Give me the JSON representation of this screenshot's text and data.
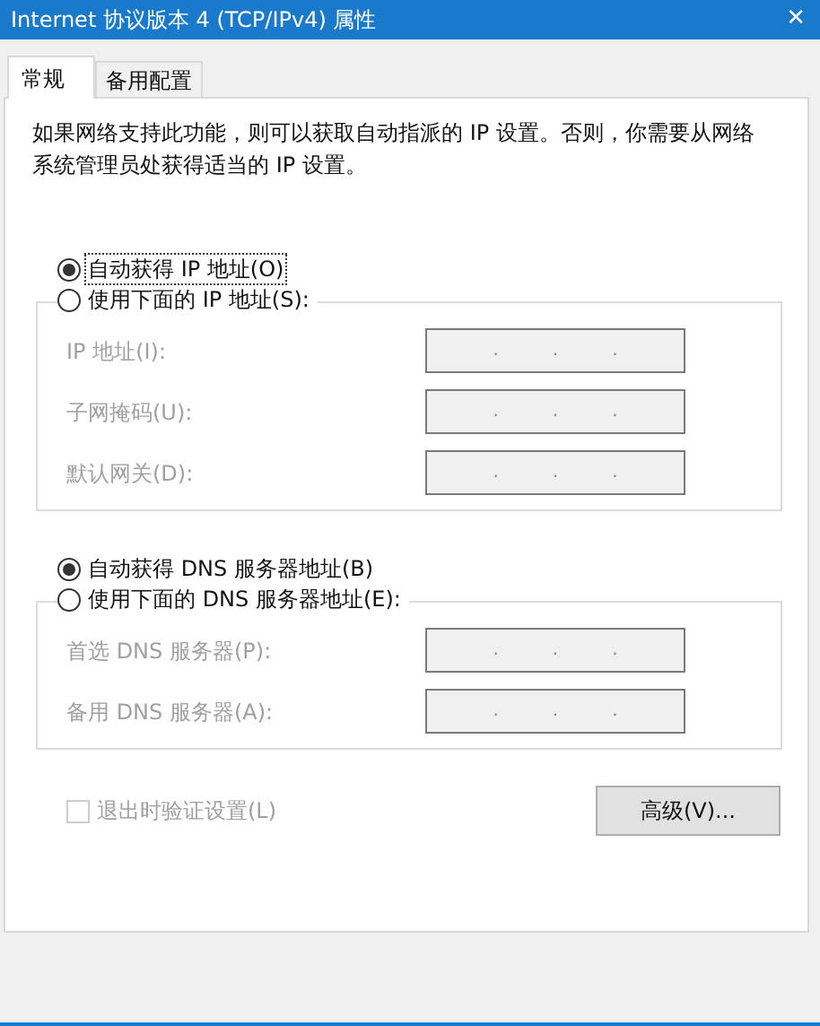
{
  "window": {
    "title": "Internet 协议版本 4 (TCP/IPv4) 属性",
    "close": "✕"
  },
  "tabs": [
    {
      "label": "常规",
      "selected": true
    },
    {
      "label": "备用配置",
      "selected": false
    }
  ],
  "description": "如果网络支持此功能，则可以获取自动指派的 IP 设置。否则，你需要从网络系统管理员处获得适当的 IP 设置。",
  "sections": [
    {
      "auto_option": {
        "label": "自动获得 IP 地址(O)",
        "selected": true,
        "focused": true
      },
      "manual_option": {
        "label": "使用下面的 IP 地址(S):",
        "selected": false
      },
      "disabled": true,
      "fields": [
        {
          "label": "IP 地址(I):",
          "separators": [
            ".",
            ".",
            "."
          ]
        },
        {
          "label": "子网掩码(U):",
          "separators": [
            ".",
            ".",
            "."
          ]
        },
        {
          "label": "默认网关(D):",
          "separators": [
            ".",
            ".",
            "."
          ]
        }
      ]
    },
    {
      "auto_option": {
        "label": "自动获得 DNS 服务器地址(B)",
        "selected": true,
        "focused": false
      },
      "manual_option": {
        "label": "使用下面的 DNS 服务器地址(E):",
        "selected": false
      },
      "disabled": true,
      "fields": [
        {
          "label": "首选 DNS 服务器(P):",
          "separators": [
            ".",
            ".",
            "."
          ]
        },
        {
          "label": "备用 DNS 服务器(A):",
          "separators": [
            ".",
            ".",
            "."
          ]
        }
      ]
    }
  ],
  "validate_checkbox": {
    "label": "退出时验证设置(L)",
    "checked": false,
    "disabled": true
  },
  "advanced_button": "高级(V)..."
}
